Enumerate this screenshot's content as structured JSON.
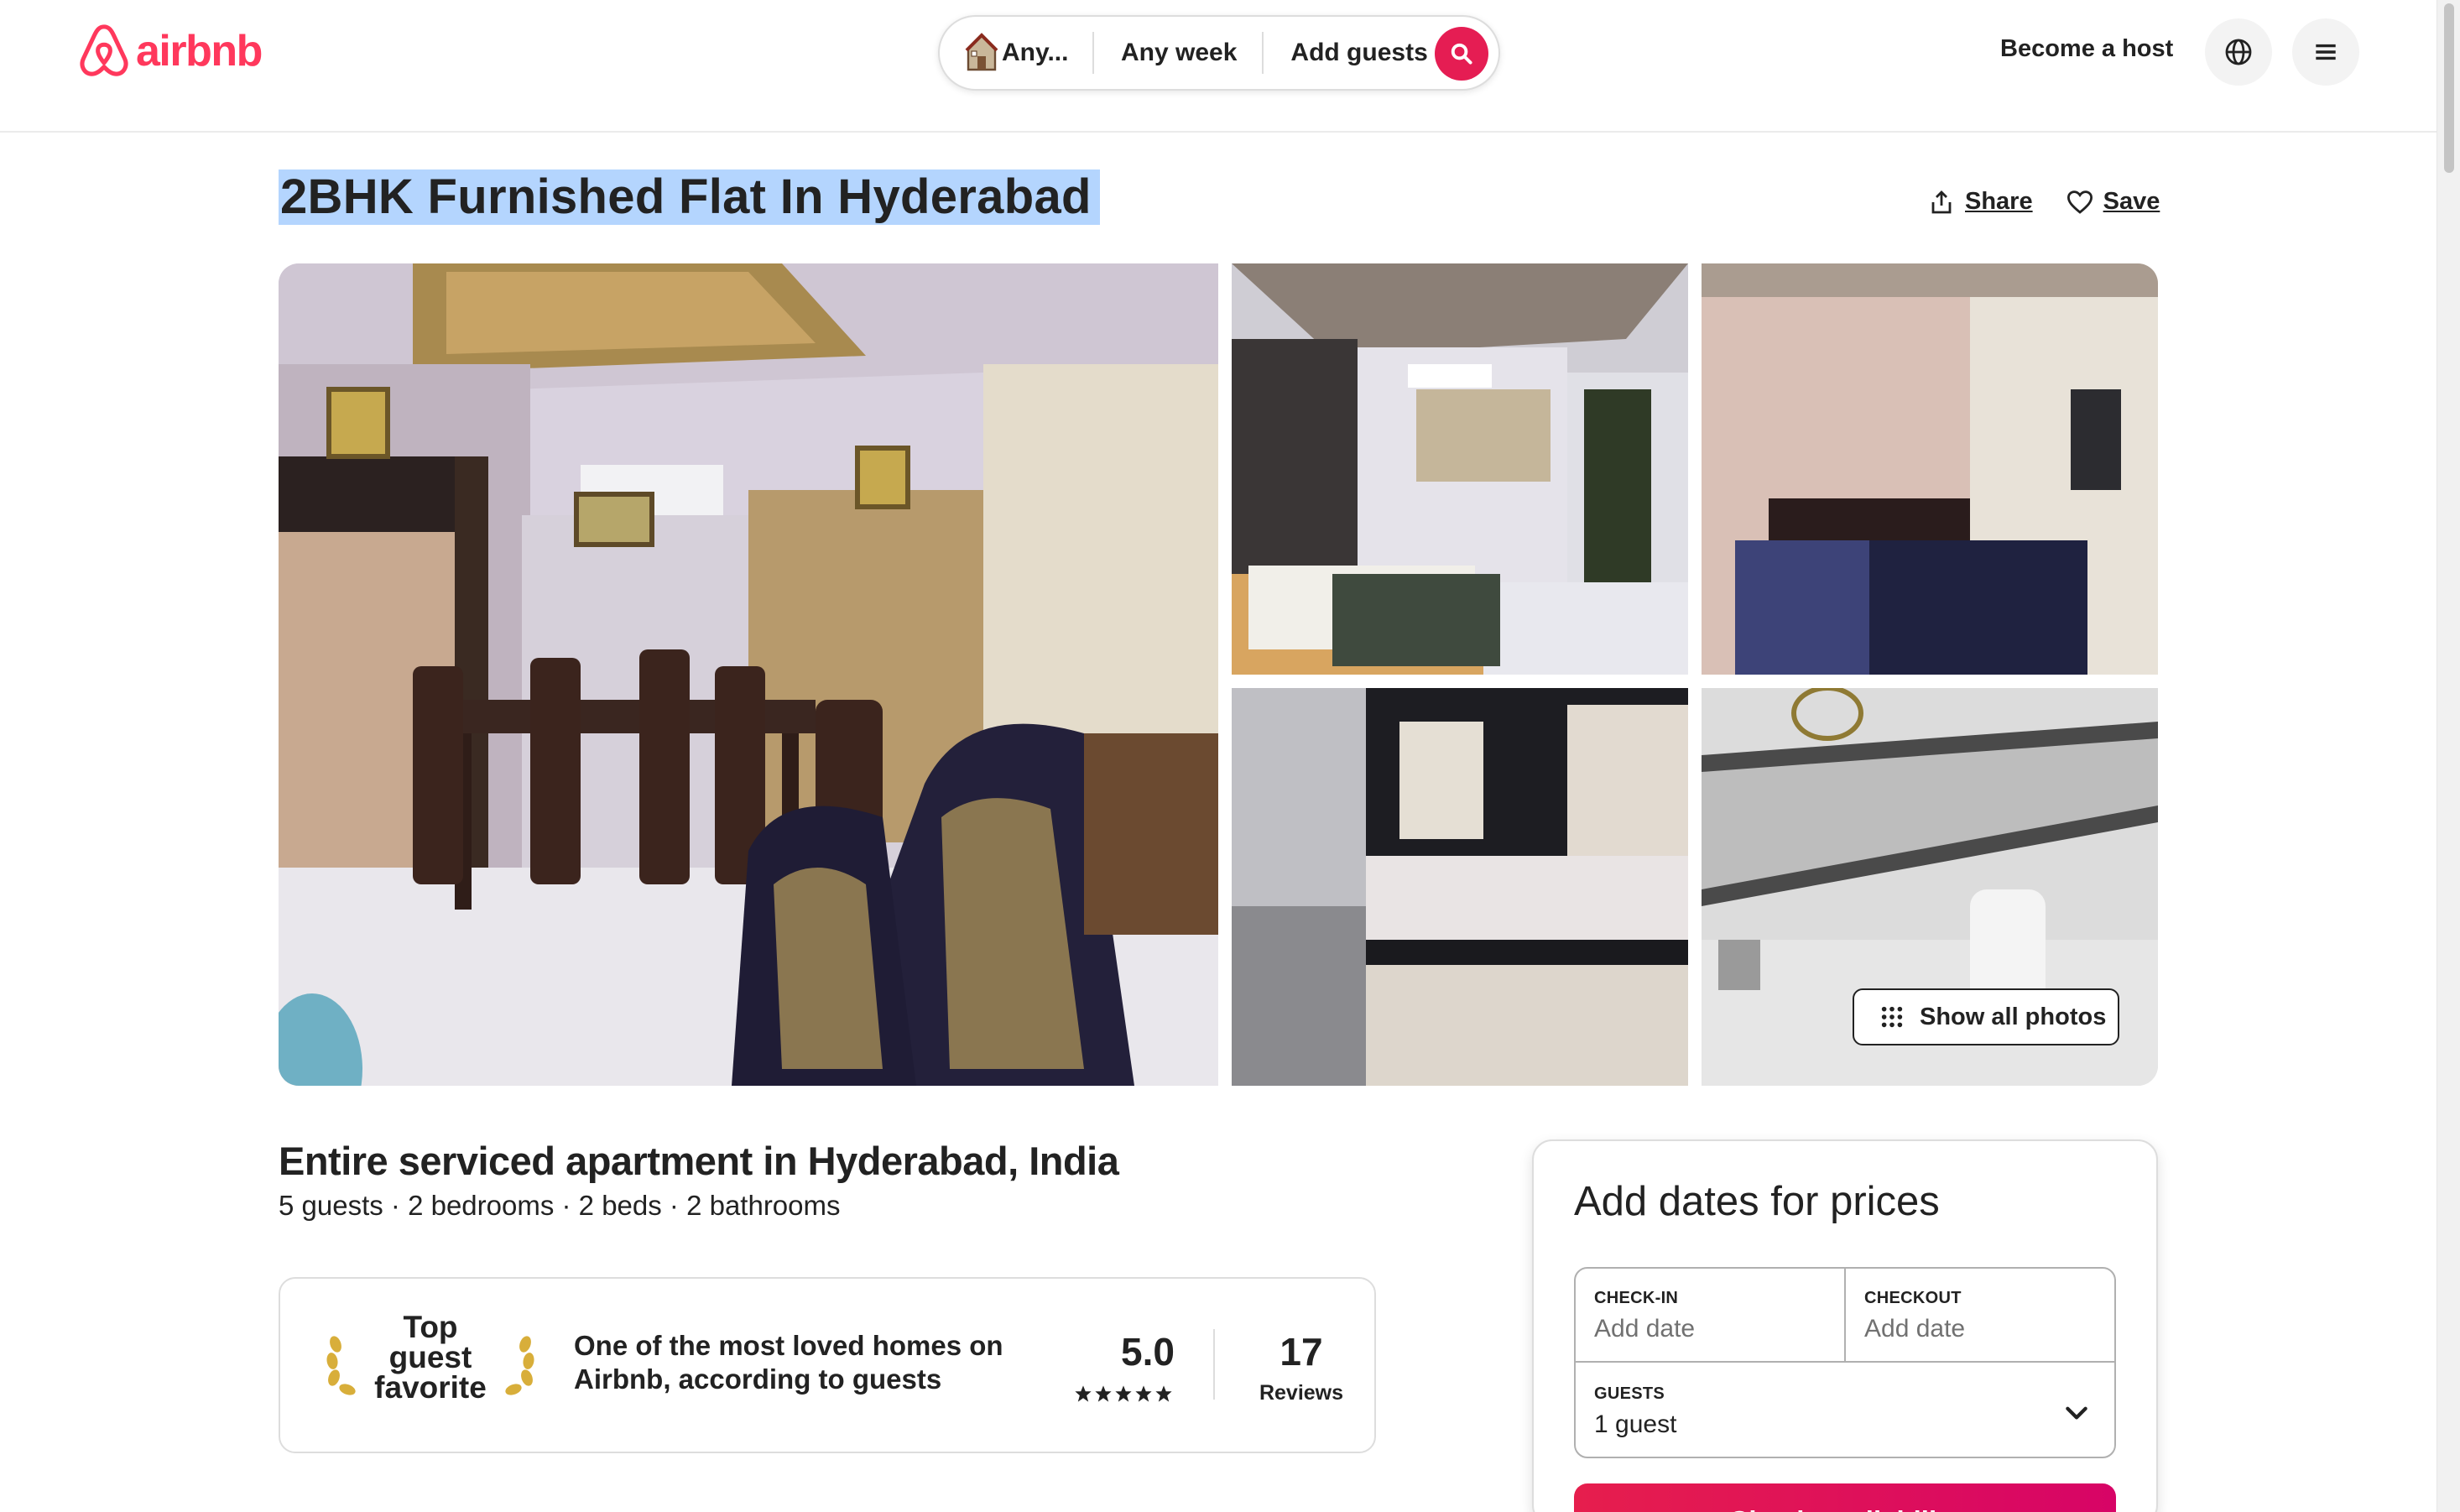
{
  "brand": {
    "name": "airbnb",
    "color": "#ff385c"
  },
  "search": {
    "where_label": "Any...",
    "when_label": "Any week",
    "guests_label": "Add guests",
    "button_color": "#e51d53"
  },
  "nav": {
    "host_label": "Become a host",
    "globe_icon": "globe-icon",
    "menu_icon": "hamburger-menu-icon"
  },
  "listing": {
    "title": "2BHK Furnished Flat In Hyderabad",
    "share_label": "Share",
    "save_label": "Save",
    "show_photos_label": "Show all photos",
    "subtitle": "Entire serviced apartment in Hyderabad, India",
    "details": "5 guests · 2 bedrooms · 2 beds · 2 bathrooms"
  },
  "guest_favorite": {
    "badge_label": "Top guest favorite",
    "description": "One of the most loved homes on Airbnb, according to guests",
    "rating": "5.0",
    "stars": 5,
    "review_count": "17",
    "reviews_label": "Reviews"
  },
  "booking": {
    "heading": "Add dates for prices",
    "checkin_label": "CHECK-IN",
    "checkin_value": "Add date",
    "checkout_label": "CHECKOUT",
    "checkout_value": "Add date",
    "guests_label": "GUESTS",
    "guests_value": "1 guest",
    "cta_label": "Check availability"
  },
  "colors": {
    "text": "#222222",
    "muted": "#717171",
    "border": "#dddddd",
    "selection": "#b4d5fe",
    "cta_gradient_start": "#e61e4d",
    "cta_gradient_end": "#d70466"
  }
}
